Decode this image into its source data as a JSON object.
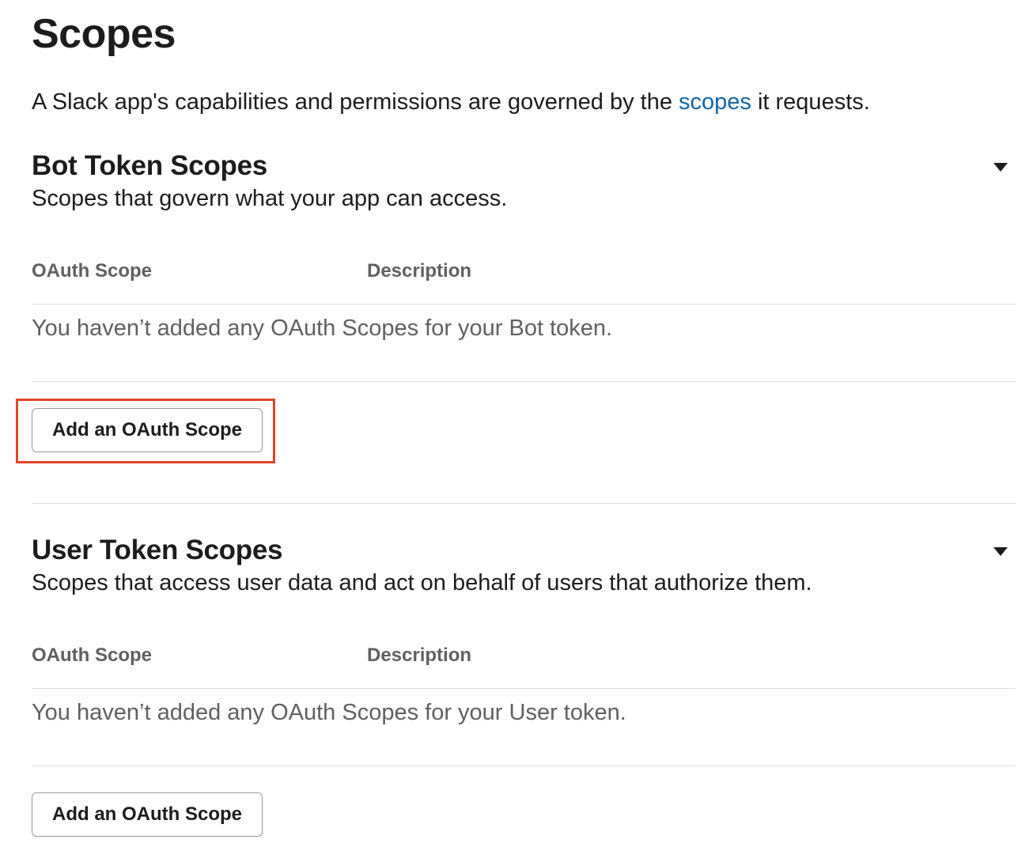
{
  "page": {
    "title": "Scopes",
    "intro_before": "A Slack app's capabilities and permissions are governed by the ",
    "intro_link": "scopes",
    "intro_after": " it requests."
  },
  "bot_section": {
    "title": "Bot Token Scopes",
    "subtitle": "Scopes that govern what your app can access.",
    "col_scope": "OAuth Scope",
    "col_description": "Description",
    "empty_message": "You haven’t added any OAuth Scopes for your Bot token.",
    "add_button": "Add an OAuth Scope"
  },
  "user_section": {
    "title": "User Token Scopes",
    "subtitle": "Scopes that access user data and act on behalf of users that authorize them.",
    "col_scope": "OAuth Scope",
    "col_description": "Description",
    "empty_message": "You haven’t added any OAuth Scopes for your User token.",
    "add_button": "Add an OAuth Scope"
  },
  "icons": {
    "collapse": "caret-down-icon"
  },
  "colors": {
    "link": "#1264a3",
    "highlight": "#e0442a",
    "muted_text": "#616061"
  }
}
